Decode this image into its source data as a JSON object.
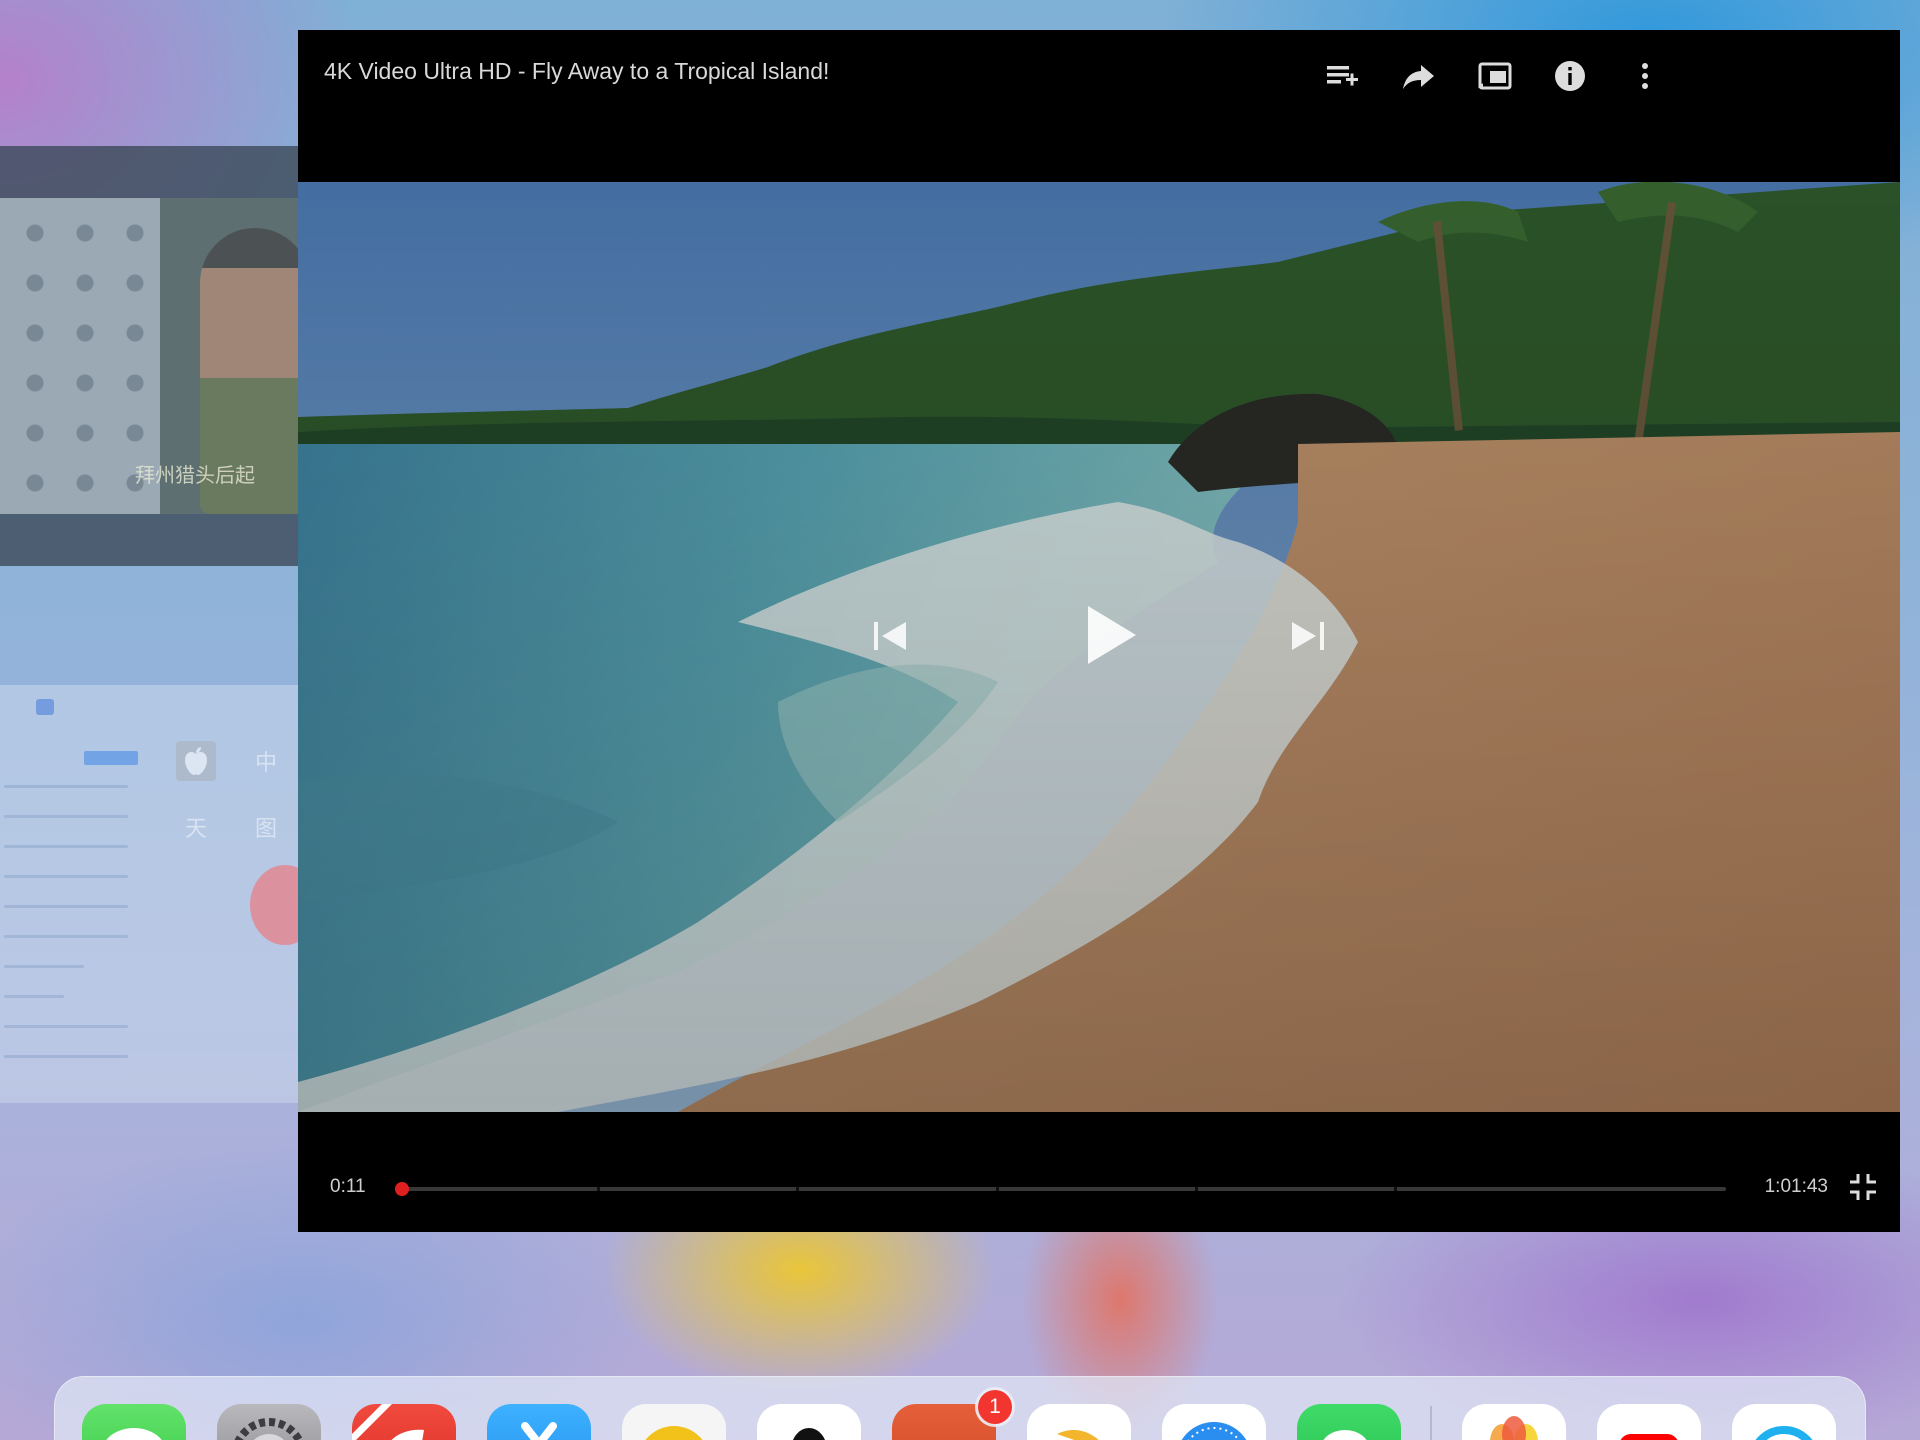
{
  "player": {
    "title": "4K Video Ultra HD - Fly Away to a Tropical Island!",
    "current_time": "0:11",
    "total_time": "1:01:43",
    "progress_fraction": 0.003,
    "progress_color": "#d21f1f",
    "top_icons": [
      "add-to-queue-icon",
      "share-icon",
      "cast-icon",
      "info-icon",
      "more-vertical-icon"
    ],
    "transport_icons": [
      "previous-icon",
      "play-icon",
      "next-icon"
    ]
  },
  "background_apps": {
    "video_subtitle": "拜州猎头后起",
    "browser_tiles": [
      {
        "icon": "apple-icon",
        "glyph": "",
        "color": "#a9b0ba"
      },
      {
        "icon": "tile-icon",
        "glyph": "中",
        "color": "#d9a86a"
      },
      {
        "icon": "tile-icon",
        "glyph": "天",
        "color": "#4d9a4d"
      },
      {
        "icon": "tile-icon",
        "glyph": "图",
        "color": "#d9555a"
      }
    ]
  },
  "dock": {
    "badge_count": "1",
    "apps": [
      {
        "name": "messages-app-icon",
        "color": "#3fcf4f",
        "glyph": ""
      },
      {
        "name": "settings-app-icon",
        "color": "#8e8e93",
        "glyph": ""
      },
      {
        "name": "hd-app-icon",
        "color": "#e8322e",
        "glyph": ""
      },
      {
        "name": "blue-app-icon",
        "color": "#2f9bf0",
        "glyph": ""
      },
      {
        "name": "yellow-app-icon",
        "color": "#f4f4f4",
        "glyph": ""
      },
      {
        "name": "qq-app-icon",
        "color": "#ffffff",
        "glyph": ""
      },
      {
        "name": "orange-app-icon",
        "color": "#e0552e",
        "glyph": ""
      },
      {
        "name": "bird-app-icon",
        "color": "#ffffff",
        "glyph": ""
      },
      {
        "name": "safari-app-icon",
        "color": "#ffffff",
        "glyph": ""
      },
      {
        "name": "wechat-app-icon",
        "color": "#2fcb56",
        "glyph": ""
      },
      {
        "name": "photos-app-icon",
        "color": "#ffffff",
        "glyph": ""
      },
      {
        "name": "youtube-app-icon",
        "color": "#ffffff",
        "glyph": ""
      },
      {
        "name": "cyan-app-icon",
        "color": "#ffffff",
        "glyph": ""
      }
    ]
  }
}
